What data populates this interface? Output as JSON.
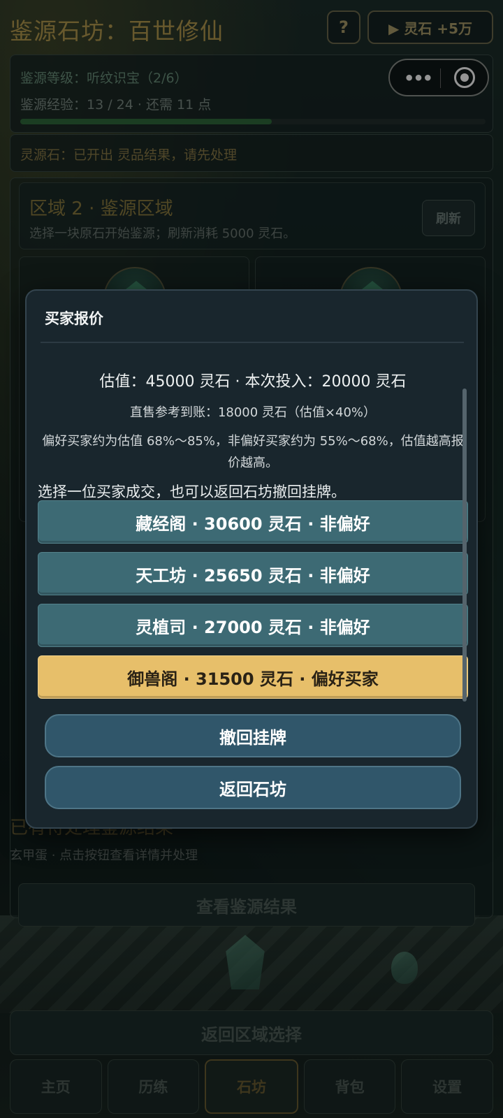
{
  "header": {
    "title": "鉴源石坊：百世修仙",
    "help_label": "?",
    "reward_label": "▶ 灵石 +5万"
  },
  "status": {
    "level_text": "鉴源等级：听纹识宝（2/6）",
    "exp_text": "鉴源经验：13 / 24 · 还需 11 点",
    "exp_progress": 0.54,
    "notice": "灵源石：已开出 灵品结果，请先处理"
  },
  "capsule": {
    "more_icon": "more-dots-icon",
    "close_icon": "target-circle-icon"
  },
  "zone": {
    "title": "区域 2 · 鉴源区域",
    "subtitle": "选择一块原石开始鉴源；刷新消耗 5000 灵石。",
    "refresh_label": "刷新"
  },
  "pending": {
    "title": "已有待处理鉴源结果",
    "subtitle": "玄甲蛋 · 点击按钮查看详情并处理",
    "view_label": "查看鉴源结果"
  },
  "back_zone_label": "返回区域选择",
  "tabs": [
    {
      "label": "主页"
    },
    {
      "label": "历练"
    },
    {
      "label": "石坊"
    },
    {
      "label": "背包"
    },
    {
      "label": "设置"
    }
  ],
  "modal": {
    "title": "买家报价",
    "value_line": "估值：45000 灵石 · 本次投入：20000 灵石",
    "direct_sale_line": "直售参考到账：18000 灵石（估值×40%）",
    "preference_line": "偏好买家约为估值 68%～85%，非偏好买家约为 55%～68%，估值越高报价越高。",
    "choose_line": "选择一位买家成交，也可以返回石坊撤回挂牌。",
    "buyers": [
      {
        "label": "藏经阁 · 30600 灵石 · 非偏好"
      },
      {
        "label": "天工坊 · 25650 灵石 · 非偏好"
      },
      {
        "label": "灵植司 · 27000 灵石 · 非偏好"
      },
      {
        "label": "御兽阁 · 31500 灵石 · 偏好买家"
      }
    ],
    "withdraw_label": "撤回挂牌",
    "return_label": "返回石坊"
  },
  "colors": {
    "accent_gold": "#e7bf6a",
    "buyer_teal": "#3d6a74",
    "action_blue": "#30566a",
    "exp_green": "#2f6a3c"
  }
}
